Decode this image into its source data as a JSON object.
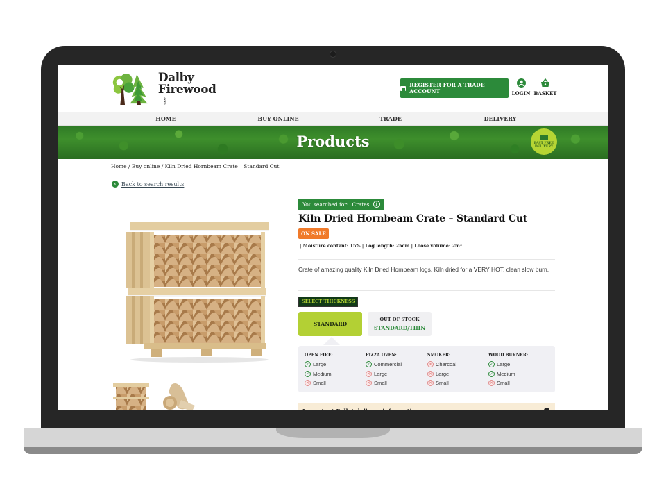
{
  "site": {
    "logo_line1": "Dalby",
    "logo_line2": "Firewood",
    "logo_suffix": ".com"
  },
  "header": {
    "trade_button": "REGISTER FOR A TRADE ACCOUNT",
    "login_label": "LOGIN",
    "basket_label": "BASKET"
  },
  "nav": {
    "items": [
      {
        "label": "HOME"
      },
      {
        "label": "BUY ONLINE"
      },
      {
        "label": "TRADE"
      },
      {
        "label": "DELIVERY"
      }
    ]
  },
  "banner": {
    "title": "Products",
    "badge_line1": "FAST FREE",
    "badge_line2": "DELIVERY"
  },
  "breadcrumb": {
    "items": [
      "Home",
      "Buy online",
      "Kiln Dried Hornbeam Crate – Standard Cut"
    ],
    "separator": "/"
  },
  "back_link": "Back to search results",
  "product": {
    "searched_prefix": "You searched for:",
    "searched_term": "Crates",
    "title": "Kiln Dried Hornbeam Crate – Standard Cut",
    "badge": "ON SALE",
    "specs": "| Moisture content: 15% | Log length: 25cm | Loose volume: 2m³",
    "description": "Crate of amazing quality Kiln Dried Hornbeam logs. Kiln dried for a VERY HOT, clean slow burn.",
    "select_label": "SELECT THICKNESS",
    "options": [
      {
        "label": "STANDARD",
        "selected": true
      },
      {
        "status": "OUT OF STOCK",
        "label": "STANDARD/THIN",
        "selected": false
      }
    ],
    "suitability": [
      {
        "heading": "OPEN FIRE:",
        "items": [
          {
            "label": "Large",
            "suitable": true
          },
          {
            "label": "Medium",
            "suitable": true
          },
          {
            "label": "Small",
            "suitable": false
          }
        ]
      },
      {
        "heading": "PIZZA OVEN:",
        "items": [
          {
            "label": "Commercial",
            "suitable": true
          },
          {
            "label": "Large",
            "suitable": false
          },
          {
            "label": "Small",
            "suitable": false
          }
        ]
      },
      {
        "heading": "SMOKER:",
        "items": [
          {
            "label": "Charcoal",
            "suitable": false
          },
          {
            "label": "Large",
            "suitable": false
          },
          {
            "label": "Small",
            "suitable": false
          }
        ]
      },
      {
        "heading": "WOOD BURNER:",
        "items": [
          {
            "label": "Large",
            "suitable": true
          },
          {
            "label": "Medium",
            "suitable": true
          },
          {
            "label": "Small",
            "suitable": false
          }
        ]
      }
    ],
    "accordion_title": "Important Pallet delivery information"
  },
  "icons": {
    "ok": "✓",
    "no": "×",
    "info": "i",
    "back": "‹"
  },
  "colors": {
    "brand_green": "#2c8a3a",
    "lime": "#b3d034",
    "sale_orange": "#f07a2a",
    "accordion_bg": "#f8ecd6"
  }
}
